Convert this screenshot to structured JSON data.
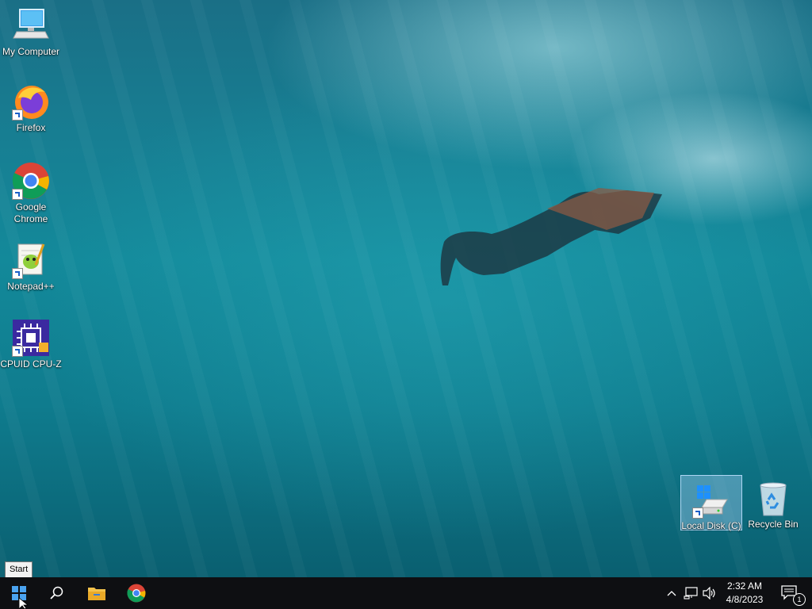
{
  "desktop": {
    "icons": [
      {
        "label": "My Computer"
      },
      {
        "label": "Firefox"
      },
      {
        "label": "Google Chrome"
      },
      {
        "label": "Notepad++"
      },
      {
        "label": "CPUID CPU-Z"
      },
      {
        "label": "Local Disk (C)"
      },
      {
        "label": "Recycle Bin"
      }
    ]
  },
  "tooltip": {
    "text": "Start"
  },
  "taskbar": {
    "buttons": [
      "start-windows-icon",
      "search-icon",
      "file-explorer-icon",
      "chrome-icon"
    ],
    "tray_icons": [
      "chevron-up-icon",
      "network-icon",
      "volume-icon"
    ],
    "time": "2:32 AM",
    "date": "4/8/2023",
    "notification_count": "1"
  },
  "colors": {
    "taskbar": "#0e0f12",
    "accent": "#0078d7"
  }
}
